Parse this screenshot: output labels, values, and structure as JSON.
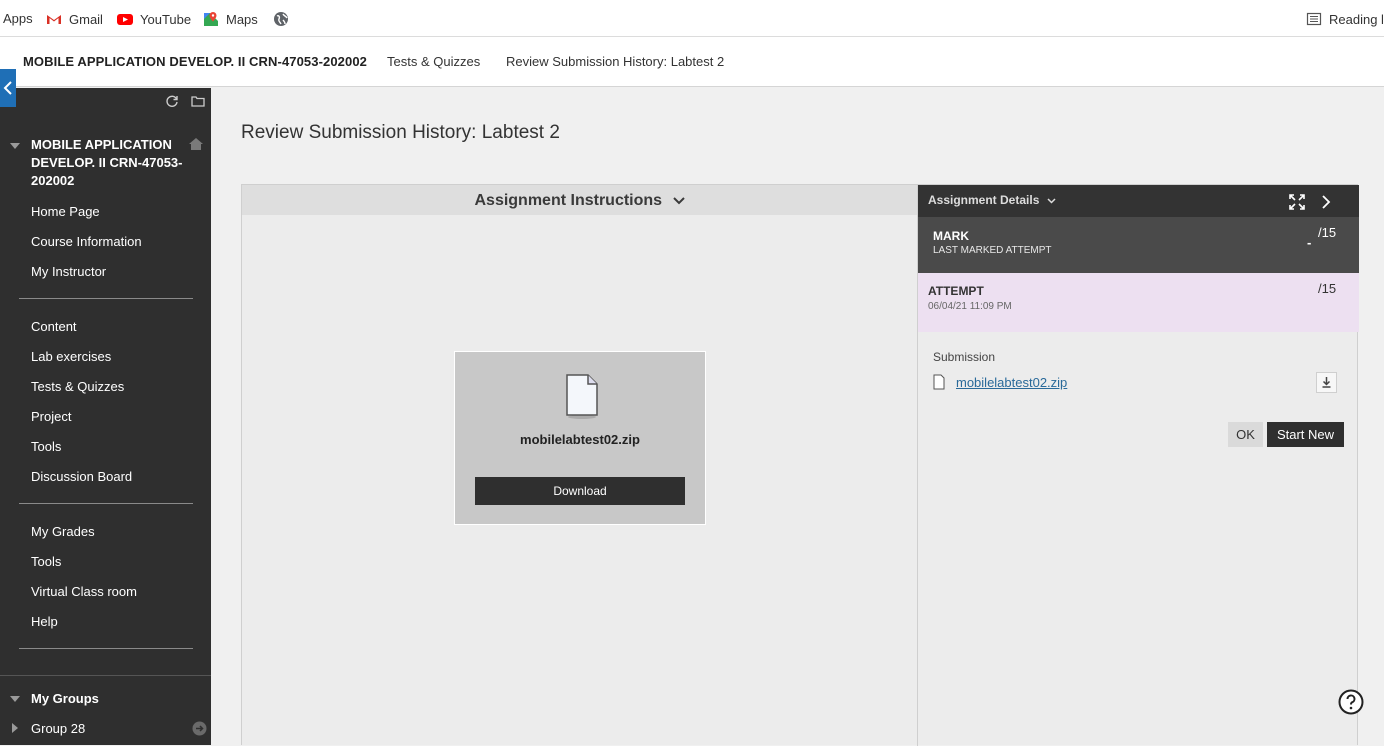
{
  "bookmarks": {
    "apps": "Apps",
    "gmail": "Gmail",
    "youtube": "YouTube",
    "maps": "Maps",
    "reading_list": "Reading lis"
  },
  "breadcrumb": {
    "course": "MOBILE APPLICATION DEVELOP. II CRN-47053-202002",
    "item1": "Tests & Quizzes",
    "item2": "Review Submission History: Labtest 2"
  },
  "sidebar": {
    "course_title": "MOBILE APPLICATION DEVELOP. II CRN-47053-202002",
    "section1": [
      {
        "label": "Home Page"
      },
      {
        "label": "Course Information"
      },
      {
        "label": "My Instructor"
      }
    ],
    "section2": [
      {
        "label": "Content"
      },
      {
        "label": "Lab exercises"
      },
      {
        "label": "Tests & Quizzes"
      },
      {
        "label": "Project"
      },
      {
        "label": "Tools"
      },
      {
        "label": "Discussion Board"
      }
    ],
    "section3": [
      {
        "label": "My Grades"
      },
      {
        "label": "Tools"
      },
      {
        "label": "Virtual Class room"
      },
      {
        "label": "Help"
      }
    ],
    "groups_title": "My Groups",
    "group_item": "Group 28"
  },
  "main": {
    "page_title": "Review Submission History: Labtest 2",
    "instructions_heading": "Assignment Instructions",
    "file_name": "mobilelabtest02.zip",
    "download_label": "Download"
  },
  "details": {
    "heading": "Assignment Details",
    "mark_label": "MARK",
    "mark_sub": "LAST MARKED ATTEMPT",
    "mark_dash": "-",
    "mark_value": "/15",
    "attempt_label": "ATTEMPT",
    "attempt_date": "06/04/21 11:09 PM",
    "attempt_value": "/15",
    "submission_label": "Submission",
    "submission_file": "mobilelabtest02.zip",
    "ok_label": "OK",
    "start_new_label": "Start New"
  },
  "colors": {
    "sidebar_bg": "#2f2f2f",
    "accent_blue": "#1f6fb6",
    "attempt_bg": "#ede0f1",
    "link": "#2a6a9a"
  }
}
